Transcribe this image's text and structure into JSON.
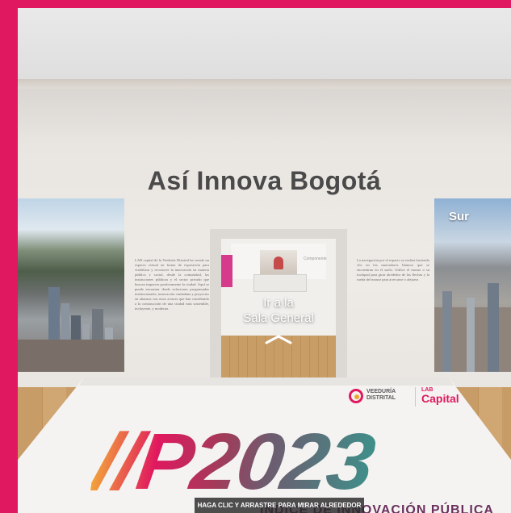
{
  "gallery": {
    "title": "Así Innova Bogotá",
    "left_panel_text": "LAB capital de la Veeduría Distrital ha creado un espacio virtual en forma de exposición para visibilizar y reconocer la innovación en materia pública y social, desde la comunidad, las instituciones públicas y el sector privado que buscan impactar positivamente la ciudad. Aquí se puede encontrar desde soluciones programadas institucionales, innovación ciudadana y proyectos en alianzas con otros actores que han contribuido a la construcción de una ciudad más sostenible, incluyente, y moderna.",
    "right_panel_text": "La navegación por el espacio se realiza haciendo clic en los marcadores blancos que se encuentran en el suelo. Utilice el mouse o su trackpad para girar alrededor de las flechas y la rueda del mouse para acercarse o alejarse.",
    "right_photo_label": "Sur",
    "doorway": {
      "room_tag": "Componente",
      "nav_line1": "Ir a la",
      "nav_line2": "Sala General"
    }
  },
  "podium": {
    "brand": "//P2023",
    "subtitle": "ÍNDICE DE INNOVACIÓN PÚBLICA",
    "logo_veeduria_line1": "VEEDURÍA",
    "logo_veeduria_line2": "DISTRITAL",
    "logo_lab": "LAB",
    "logo_capital": "Capital"
  },
  "hint": {
    "text": "HAGA CLIC Y ARRASTRE PARA MIRAR ALREDEDOR"
  },
  "colors": {
    "frame": "#e0185f",
    "accent_orange": "#f2a33a",
    "accent_teal": "#3f8f8a"
  }
}
